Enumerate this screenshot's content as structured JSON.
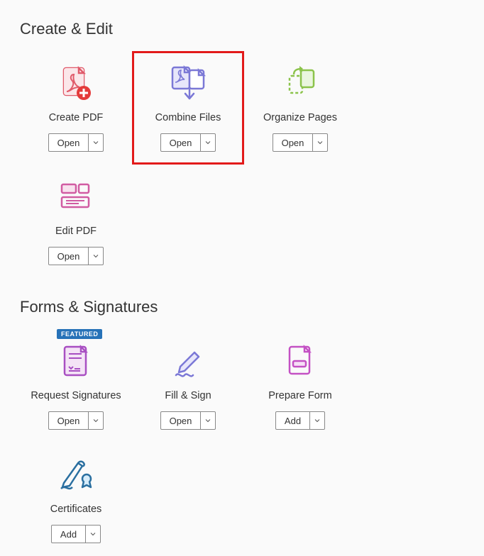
{
  "sections": [
    {
      "title": "Create & Edit",
      "tools": [
        {
          "label": "Create PDF",
          "button": "Open",
          "icon": "create-pdf-icon",
          "highlighted": false,
          "badge": null
        },
        {
          "label": "Combine Files",
          "button": "Open",
          "icon": "combine-files-icon",
          "highlighted": true,
          "badge": null
        },
        {
          "label": "Organize Pages",
          "button": "Open",
          "icon": "organize-pages-icon",
          "highlighted": false,
          "badge": null
        },
        {
          "label": "Edit PDF",
          "button": "Open",
          "icon": "edit-pdf-icon",
          "highlighted": false,
          "badge": null
        }
      ]
    },
    {
      "title": "Forms & Signatures",
      "tools": [
        {
          "label": "Request Signatures",
          "button": "Open",
          "icon": "request-signatures-icon",
          "highlighted": false,
          "badge": "FEATURED"
        },
        {
          "label": "Fill & Sign",
          "button": "Open",
          "icon": "fill-sign-icon",
          "highlighted": false,
          "badge": null
        },
        {
          "label": "Prepare Form",
          "button": "Add",
          "icon": "prepare-form-icon",
          "highlighted": false,
          "badge": null
        },
        {
          "label": "Certificates",
          "button": "Add",
          "icon": "certificates-icon",
          "highlighted": false,
          "badge": null
        }
      ]
    }
  ]
}
